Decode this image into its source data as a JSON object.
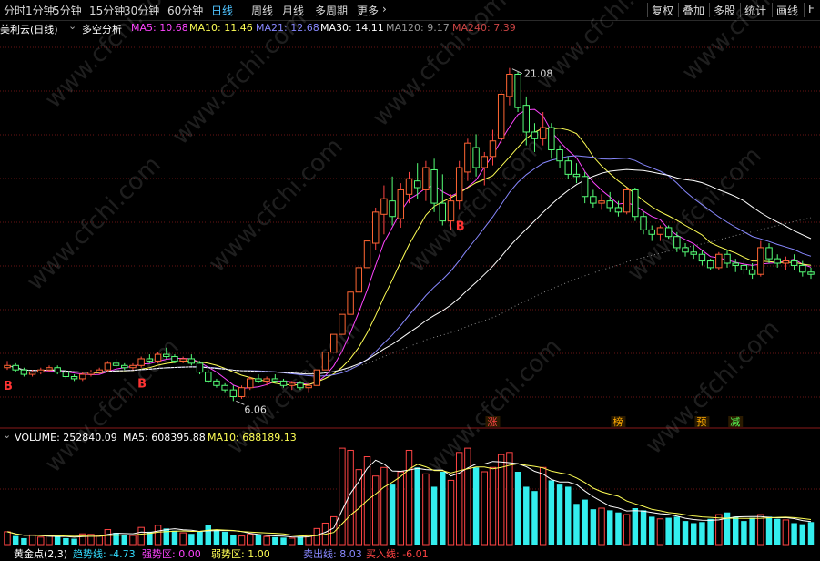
{
  "toolbar": {
    "periods": [
      "分时",
      "1分钟",
      "5分钟",
      "15分钟",
      "30分钟",
      "60分钟",
      "日线",
      "周线",
      "月线",
      "多周期",
      "更多"
    ],
    "active_period": "日线",
    "right_buttons": [
      "复权",
      "叠加",
      "多股",
      "统计",
      "画线",
      "F"
    ]
  },
  "price_legend": {
    "stock": "美利云(日线)",
    "indicator": "多空分析",
    "ma": [
      {
        "label": "MA5: 10.68",
        "color": "#ff44ff"
      },
      {
        "label": "MA10: 11.46",
        "color": "#ffff55"
      },
      {
        "label": "MA21: 12.68",
        "color": "#8888ff"
      },
      {
        "label": "MA30: 14.11",
        "color": "#ffffff"
      },
      {
        "label": "MA120: 9.17",
        "color": "#999999"
      },
      {
        "label": "MA240: 7.39",
        "color": "#cc4444"
      }
    ]
  },
  "volume_legend": {
    "title": "VOLUME: 252840.09",
    "ma5": "MA5: 608395.88",
    "ma10": "MA10: 688189.13"
  },
  "indicator_legend": {
    "name": "黄金点(2,3)",
    "items": [
      {
        "label": "趋势线: -4.73",
        "color": "#33ddff"
      },
      {
        "label": "强势区: 0.00",
        "color": "#ff44ff"
      },
      {
        "label": "弱势区: 1.00",
        "color": "#ffff55"
      },
      {
        "label": "卖出线: 8.03",
        "color": "#8888ff"
      },
      {
        "label": "买入线: -6.01",
        "color": "#ff4444"
      }
    ]
  },
  "annotations": {
    "high": "21.08",
    "low": "6.06",
    "markers": [
      {
        "text": "涨",
        "color": "#ff4444"
      },
      {
        "text": "榜",
        "color": "#ffaa00"
      },
      {
        "text": "预",
        "color": "#ffaa00"
      },
      {
        "text": "减",
        "color": "#55ff55"
      }
    ],
    "buy_signal": "B"
  },
  "watermark": "www.cfchi.com",
  "chart_data": {
    "type": "candlestick",
    "title": "美利云(日线)",
    "ohlc": [
      [
        7.6,
        7.9,
        7.5,
        7.7
      ],
      [
        7.7,
        7.8,
        7.4,
        7.5
      ],
      [
        7.5,
        7.6,
        7.2,
        7.3
      ],
      [
        7.3,
        7.5,
        7.2,
        7.4
      ],
      [
        7.4,
        7.6,
        7.3,
        7.5
      ],
      [
        7.5,
        7.7,
        7.4,
        7.6
      ],
      [
        7.6,
        7.7,
        7.3,
        7.4
      ],
      [
        7.4,
        7.5,
        7.1,
        7.2
      ],
      [
        7.2,
        7.3,
        7.0,
        7.1
      ],
      [
        7.1,
        7.4,
        7.0,
        7.3
      ],
      [
        7.3,
        7.5,
        7.2,
        7.4
      ],
      [
        7.4,
        7.6,
        7.3,
        7.5
      ],
      [
        7.5,
        7.9,
        7.4,
        7.8
      ],
      [
        7.8,
        8.0,
        7.6,
        7.7
      ],
      [
        7.7,
        7.8,
        7.5,
        7.6
      ],
      [
        7.6,
        7.8,
        7.5,
        7.7
      ],
      [
        7.7,
        8.1,
        7.6,
        8.0
      ],
      [
        8.0,
        8.2,
        7.8,
        7.9
      ],
      [
        7.9,
        8.3,
        7.8,
        8.2
      ],
      [
        8.2,
        8.5,
        8.0,
        8.1
      ],
      [
        8.1,
        8.2,
        7.8,
        7.9
      ],
      [
        7.9,
        8.1,
        7.8,
        8.0
      ],
      [
        8.0,
        8.2,
        7.7,
        7.8
      ],
      [
        7.8,
        7.9,
        7.3,
        7.4
      ],
      [
        7.4,
        7.5,
        6.9,
        7.0
      ],
      [
        7.0,
        7.1,
        6.7,
        6.8
      ],
      [
        6.8,
        6.9,
        6.5,
        6.6
      ],
      [
        6.6,
        6.8,
        6.1,
        6.3
      ],
      [
        6.3,
        6.8,
        6.2,
        6.7
      ],
      [
        6.7,
        7.2,
        6.6,
        7.1
      ],
      [
        7.1,
        7.3,
        6.9,
        7.0
      ],
      [
        7.0,
        7.2,
        6.8,
        7.1
      ],
      [
        7.1,
        7.3,
        6.9,
        7.0
      ],
      [
        7.0,
        7.1,
        6.7,
        6.8
      ],
      [
        6.8,
        7.0,
        6.6,
        6.9
      ],
      [
        6.9,
        7.0,
        6.6,
        6.7
      ],
      [
        6.7,
        6.9,
        6.5,
        6.8
      ],
      [
        6.8,
        7.5,
        6.8,
        7.5
      ],
      [
        7.5,
        8.3,
        7.5,
        8.3
      ],
      [
        8.3,
        9.1,
        8.3,
        9.1
      ],
      [
        9.1,
        10.0,
        9.1,
        10.0
      ],
      [
        10.0,
        11.0,
        10.0,
        11.0
      ],
      [
        11.0,
        12.1,
        11.0,
        12.1
      ],
      [
        12.1,
        13.3,
        12.1,
        13.3
      ],
      [
        13.2,
        14.8,
        12.9,
        14.6
      ],
      [
        14.5,
        15.8,
        13.6,
        15.2
      ],
      [
        15.1,
        16.2,
        14.0,
        14.4
      ],
      [
        14.3,
        15.9,
        13.9,
        15.6
      ],
      [
        15.4,
        16.4,
        15.0,
        16.1
      ],
      [
        16.0,
        16.8,
        15.2,
        15.7
      ],
      [
        15.6,
        16.9,
        15.1,
        16.6
      ],
      [
        16.5,
        17.0,
        14.6,
        15.0
      ],
      [
        15.0,
        16.3,
        14.0,
        14.2
      ],
      [
        14.2,
        15.4,
        13.8,
        15.1
      ],
      [
        15.1,
        16.9,
        14.7,
        16.6
      ],
      [
        16.4,
        17.9,
        16.0,
        17.7
      ],
      [
        17.5,
        18.1,
        16.2,
        16.6
      ],
      [
        16.6,
        17.3,
        15.8,
        17.1
      ],
      [
        17.1,
        18.3,
        16.7,
        17.8
      ],
      [
        17.9,
        20.0,
        17.7,
        19.9
      ],
      [
        19.8,
        21.08,
        19.4,
        20.8
      ],
      [
        20.8,
        20.9,
        19.1,
        19.3
      ],
      [
        19.4,
        19.8,
        17.6,
        18.2
      ],
      [
        18.2,
        18.6,
        17.3,
        17.9
      ],
      [
        17.9,
        19.1,
        17.6,
        18.4
      ],
      [
        18.4,
        18.6,
        17.0,
        17.4
      ],
      [
        17.4,
        17.6,
        16.6,
        16.9
      ],
      [
        16.9,
        17.1,
        16.1,
        16.3
      ],
      [
        16.3,
        16.8,
        15.9,
        16.2
      ],
      [
        16.2,
        16.4,
        15.0,
        15.3
      ],
      [
        15.3,
        15.6,
        14.8,
        15.0
      ],
      [
        15.0,
        15.4,
        14.7,
        15.1
      ],
      [
        15.1,
        15.5,
        14.6,
        14.8
      ],
      [
        14.8,
        15.1,
        14.4,
        14.6
      ],
      [
        14.6,
        15.7,
        14.5,
        15.6
      ],
      [
        15.6,
        15.7,
        14.2,
        14.4
      ],
      [
        14.4,
        14.6,
        13.6,
        13.8
      ],
      [
        13.8,
        14.0,
        13.3,
        13.6
      ],
      [
        13.6,
        14.0,
        13.3,
        13.9
      ],
      [
        13.9,
        14.0,
        13.4,
        13.5
      ],
      [
        13.5,
        13.7,
        12.8,
        13.0
      ],
      [
        13.0,
        13.2,
        12.6,
        12.8
      ],
      [
        12.8,
        13.1,
        12.5,
        12.7
      ],
      [
        12.7,
        12.9,
        12.2,
        12.4
      ],
      [
        12.4,
        12.5,
        12.0,
        12.1
      ],
      [
        12.1,
        12.8,
        12.0,
        12.7
      ],
      [
        12.7,
        12.9,
        12.1,
        12.3
      ],
      [
        12.3,
        12.5,
        11.9,
        12.2
      ],
      [
        12.2,
        12.4,
        11.8,
        12.0
      ],
      [
        12.0,
        12.3,
        11.6,
        11.8
      ],
      [
        11.8,
        13.3,
        11.7,
        13.0
      ],
      [
        13.0,
        13.2,
        12.3,
        12.5
      ],
      [
        12.5,
        12.7,
        12.1,
        12.3
      ],
      [
        12.3,
        12.6,
        12.0,
        12.4
      ],
      [
        12.4,
        12.7,
        12.0,
        12.2
      ],
      [
        12.2,
        12.4,
        11.7,
        11.9
      ],
      [
        11.9,
        12.1,
        11.6,
        11.8
      ]
    ],
    "volume": [
      120,
      80,
      60,
      90,
      70,
      85,
      75,
      60,
      55,
      100,
      95,
      80,
      140,
      110,
      90,
      85,
      160,
      120,
      180,
      150,
      130,
      110,
      100,
      120,
      180,
      140,
      120,
      90,
      80,
      95,
      85,
      75,
      70,
      65,
      60,
      75,
      90,
      150,
      200,
      260,
      900,
      880,
      700,
      820,
      640,
      720,
      560,
      680,
      880,
      720,
      660,
      540,
      680,
      600,
      860,
      900,
      720,
      680,
      720,
      840,
      860,
      680,
      540,
      500,
      720,
      600,
      560,
      540,
      380,
      420,
      330,
      340,
      320,
      300,
      280,
      340,
      320,
      260,
      240,
      250,
      260,
      220,
      200,
      210,
      240,
      280,
      300,
      260,
      220,
      250,
      280,
      260,
      240,
      230,
      200,
      190,
      210
    ],
    "ylim": [
      5.5,
      22.5
    ]
  }
}
